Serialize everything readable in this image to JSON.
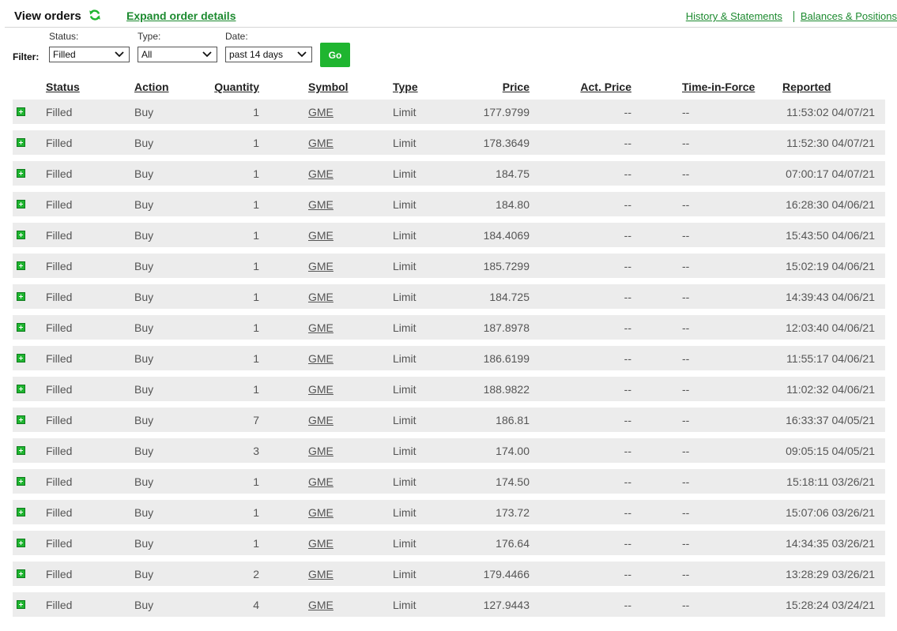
{
  "header": {
    "title": "View orders",
    "refresh_icon": "refresh-icon",
    "expand_label": "Expand order details",
    "links": [
      "History & Statements",
      "Balances & Positions"
    ]
  },
  "filters": {
    "label": "Filter:",
    "status": {
      "label": "Status:",
      "value": "Filled"
    },
    "type": {
      "label": "Type:",
      "value": "All"
    },
    "date": {
      "label": "Date:",
      "value": "past 14 days"
    },
    "go_label": "Go"
  },
  "colors": {
    "accent": "#1c8a2f",
    "button": "#1fb530",
    "row_bg": "#ececec"
  },
  "table": {
    "columns": [
      "Status",
      "Action",
      "Quantity",
      "Symbol",
      "Type",
      "Price",
      "Act. Price",
      "Time-in-Force",
      "Reported"
    ],
    "rows": [
      {
        "status": "Filled",
        "action": "Buy",
        "quantity": "1",
        "symbol": "GME",
        "type": "Limit",
        "price": "177.9799",
        "act_price": "--",
        "tif": "--",
        "reported": "11:53:02 04/07/21"
      },
      {
        "status": "Filled",
        "action": "Buy",
        "quantity": "1",
        "symbol": "GME",
        "type": "Limit",
        "price": "178.3649",
        "act_price": "--",
        "tif": "--",
        "reported": "11:52:30 04/07/21"
      },
      {
        "status": "Filled",
        "action": "Buy",
        "quantity": "1",
        "symbol": "GME",
        "type": "Limit",
        "price": "184.75",
        "act_price": "--",
        "tif": "--",
        "reported": "07:00:17 04/07/21"
      },
      {
        "status": "Filled",
        "action": "Buy",
        "quantity": "1",
        "symbol": "GME",
        "type": "Limit",
        "price": "184.80",
        "act_price": "--",
        "tif": "--",
        "reported": "16:28:30 04/06/21"
      },
      {
        "status": "Filled",
        "action": "Buy",
        "quantity": "1",
        "symbol": "GME",
        "type": "Limit",
        "price": "184.4069",
        "act_price": "--",
        "tif": "--",
        "reported": "15:43:50 04/06/21"
      },
      {
        "status": "Filled",
        "action": "Buy",
        "quantity": "1",
        "symbol": "GME",
        "type": "Limit",
        "price": "185.7299",
        "act_price": "--",
        "tif": "--",
        "reported": "15:02:19 04/06/21"
      },
      {
        "status": "Filled",
        "action": "Buy",
        "quantity": "1",
        "symbol": "GME",
        "type": "Limit",
        "price": "184.725",
        "act_price": "--",
        "tif": "--",
        "reported": "14:39:43 04/06/21"
      },
      {
        "status": "Filled",
        "action": "Buy",
        "quantity": "1",
        "symbol": "GME",
        "type": "Limit",
        "price": "187.8978",
        "act_price": "--",
        "tif": "--",
        "reported": "12:03:40 04/06/21"
      },
      {
        "status": "Filled",
        "action": "Buy",
        "quantity": "1",
        "symbol": "GME",
        "type": "Limit",
        "price": "186.6199",
        "act_price": "--",
        "tif": "--",
        "reported": "11:55:17 04/06/21"
      },
      {
        "status": "Filled",
        "action": "Buy",
        "quantity": "1",
        "symbol": "GME",
        "type": "Limit",
        "price": "188.9822",
        "act_price": "--",
        "tif": "--",
        "reported": "11:02:32 04/06/21"
      },
      {
        "status": "Filled",
        "action": "Buy",
        "quantity": "7",
        "symbol": "GME",
        "type": "Limit",
        "price": "186.81",
        "act_price": "--",
        "tif": "--",
        "reported": "16:33:37 04/05/21"
      },
      {
        "status": "Filled",
        "action": "Buy",
        "quantity": "3",
        "symbol": "GME",
        "type": "Limit",
        "price": "174.00",
        "act_price": "--",
        "tif": "--",
        "reported": "09:05:15 04/05/21"
      },
      {
        "status": "Filled",
        "action": "Buy",
        "quantity": "1",
        "symbol": "GME",
        "type": "Limit",
        "price": "174.50",
        "act_price": "--",
        "tif": "--",
        "reported": "15:18:11 03/26/21"
      },
      {
        "status": "Filled",
        "action": "Buy",
        "quantity": "1",
        "symbol": "GME",
        "type": "Limit",
        "price": "173.72",
        "act_price": "--",
        "tif": "--",
        "reported": "15:07:06 03/26/21"
      },
      {
        "status": "Filled",
        "action": "Buy",
        "quantity": "1",
        "symbol": "GME",
        "type": "Limit",
        "price": "176.64",
        "act_price": "--",
        "tif": "--",
        "reported": "14:34:35 03/26/21"
      },
      {
        "status": "Filled",
        "action": "Buy",
        "quantity": "2",
        "symbol": "GME",
        "type": "Limit",
        "price": "179.4466",
        "act_price": "--",
        "tif": "--",
        "reported": "13:28:29 03/26/21"
      },
      {
        "status": "Filled",
        "action": "Buy",
        "quantity": "4",
        "symbol": "GME",
        "type": "Limit",
        "price": "127.9443",
        "act_price": "--",
        "tif": "--",
        "reported": "15:28:24 03/24/21"
      }
    ]
  }
}
